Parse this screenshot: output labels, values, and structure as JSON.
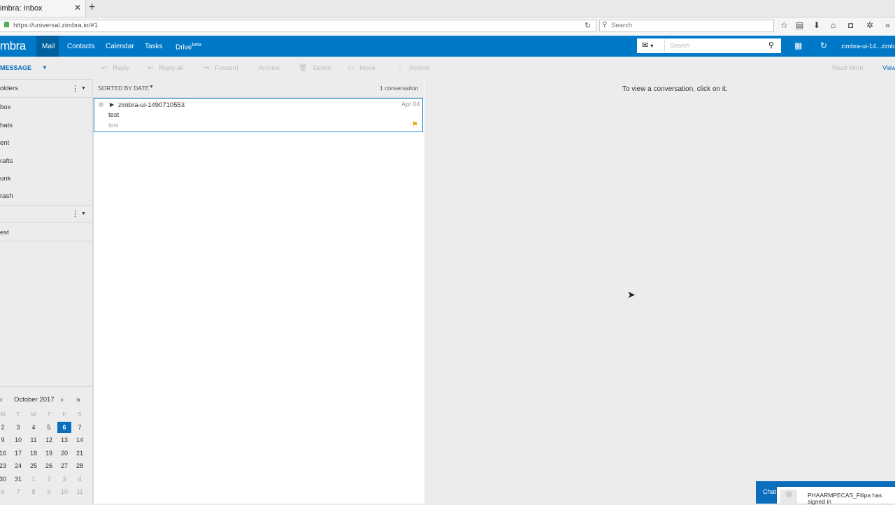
{
  "browser": {
    "tab_title": "imbra: Inbox",
    "tab_close": "✕",
    "new_tab": "+",
    "url": "https://universal.zimbra.io/#1",
    "reload_icon": "↻",
    "search_placeholder": "Search",
    "toolbar_icons": [
      "star-icon",
      "reading-list-icon",
      "download-icon",
      "home-icon",
      "pocket-icon",
      "extension-icon",
      "menu-overflow-icon"
    ]
  },
  "app": {
    "logo": "mbra",
    "nav": [
      {
        "label": "Mail"
      },
      {
        "label": "Contacts"
      },
      {
        "label": "Calendar"
      },
      {
        "label": "Tasks"
      },
      {
        "label": "Drive",
        "sup": "beta"
      }
    ],
    "search": {
      "scope_icon": "✉",
      "scope_caret": "▾",
      "placeholder": "Search",
      "button_icon": "⚲"
    },
    "account": "zimbra-ui-14...zimbr"
  },
  "toolbar": {
    "new_message": "MESSAGE",
    "buttons": [
      {
        "label": "Reply",
        "icon": "↩"
      },
      {
        "label": "Reply all",
        "icon": "↩"
      },
      {
        "label": "Forward",
        "icon": "↪"
      },
      {
        "label": "Archive",
        "icon": ""
      },
      {
        "label": "Delete",
        "icon": "🗑"
      },
      {
        "label": "Move",
        "icon": "▭"
      },
      {
        "label": "Actions",
        "icon": "⋮"
      }
    ],
    "read_more": "Read More",
    "view": "View"
  },
  "sidebar": {
    "folders_title": "olders",
    "folders": [
      "box",
      "hats",
      "ent",
      "rafts",
      "unk",
      "rash"
    ],
    "tags": [
      "est"
    ]
  },
  "calendar": {
    "month": "October 2017",
    "dow": [
      "M",
      "T",
      "W",
      "T",
      "F",
      "S"
    ],
    "weeks": [
      [
        "2",
        "3",
        "4",
        "5",
        "6",
        "7"
      ],
      [
        "9",
        "10",
        "11",
        "12",
        "13",
        "14"
      ],
      [
        "16",
        "17",
        "18",
        "19",
        "20",
        "21"
      ],
      [
        "23",
        "24",
        "25",
        "26",
        "27",
        "28"
      ],
      [
        "30",
        "31",
        "1",
        "2",
        "3",
        "4"
      ],
      [
        "6",
        "7",
        "8",
        "9",
        "10",
        "11"
      ]
    ],
    "today": "6"
  },
  "message_list": {
    "sort_label": "SORTED BY DATE",
    "count_label": "1 conversation",
    "conversations": [
      {
        "from": "zimbra-ui-1490710553",
        "count": "2",
        "date": "Apr 04",
        "subject": "test",
        "snippet": "test",
        "flagged": true
      }
    ]
  },
  "reading_pane": {
    "empty_text": "To view a conversation, click on it."
  },
  "chat": {
    "label": "Chat",
    "toast": "PHAARMPECAS_Filipa has signed in"
  }
}
